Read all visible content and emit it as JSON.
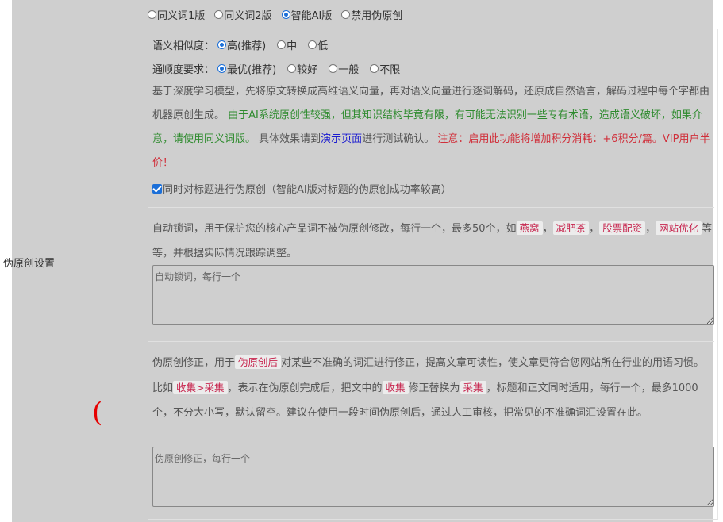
{
  "row_label": "伪原创设置",
  "paren": "(",
  "modes": [
    {
      "label": "同义词1版",
      "checked": false
    },
    {
      "label": "同义词2版",
      "checked": false
    },
    {
      "label": "智能AI版",
      "checked": true
    },
    {
      "label": "禁用伪原创",
      "checked": false
    }
  ],
  "similarity": {
    "label": "语义相似度：",
    "options": [
      {
        "label": "高(推荐)",
        "checked": true
      },
      {
        "label": "中",
        "checked": false
      },
      {
        "label": "低",
        "checked": false
      }
    ]
  },
  "fluency": {
    "label": "通顺度要求：",
    "options": [
      {
        "label": "最优(推荐)",
        "checked": true
      },
      {
        "label": "较好",
        "checked": false
      },
      {
        "label": "一般",
        "checked": false
      },
      {
        "label": "不限",
        "checked": false
      }
    ]
  },
  "description": {
    "part1": "基于深度学习模型，先将原文转换成高维语义向量，再对语义向量进行逐词解码，还原成自然语言，解码过程中每个字都由机器原创生成。",
    "warning_green": "由于AI系统原创性较强，但其知识结构毕竟有限，有可能无法识别一些专有术语，造成语义破坏，如果介意，请使用同义词版。",
    "part2": "具体效果请到",
    "demo_link": "演示页面",
    "part3": "进行测试确认。",
    "notice_red": "注意：启用此功能将增加积分消耗：+6积分/篇。VIP用户半价！"
  },
  "title_checkbox": {
    "label": "同时对标题进行伪原创（智能AI版对标题的伪原创成功率较高）",
    "checked": true
  },
  "lock_words": {
    "intro": "自动锁词，用于保护您的核心产品词不被伪原创修改，每行一个，最多50个，如",
    "examples": [
      "燕窝",
      "减肥茶",
      "股票配资",
      "网站优化"
    ],
    "sep": "，",
    "suffix": "等等，并根据实际情况跟踪调整。",
    "placeholder": "自动锁词，每行一个",
    "value": ""
  },
  "correction": {
    "p1": "伪原创修正，用于",
    "tag1": "伪原创后",
    "p2": "对某些不准确的词汇进行修正，提高文章可读性，使文章更符合您网站所在行业的用语习惯。比如",
    "tag2": "收集>采集",
    "p3": "，表示在伪原创完成后，把文中的",
    "tag3": "收集",
    "p4": "修正替换为",
    "tag4": "采集",
    "p5": "，标题和正文同时适用，每行一个，最多1000个，不分大小写，默认留空。建议在使用一段时间伪原创后，通过人工审核，把常见的不准确词汇设置在此。",
    "placeholder": "伪原创修正，每行一个",
    "value": ""
  },
  "colors": {
    "panel_bg": "#cfcfcf",
    "accent": "#1b6fd8",
    "green": "#2e8b2e",
    "red": "#d0303b",
    "link": "#1a1ad0",
    "tag_text": "#c7254e"
  }
}
